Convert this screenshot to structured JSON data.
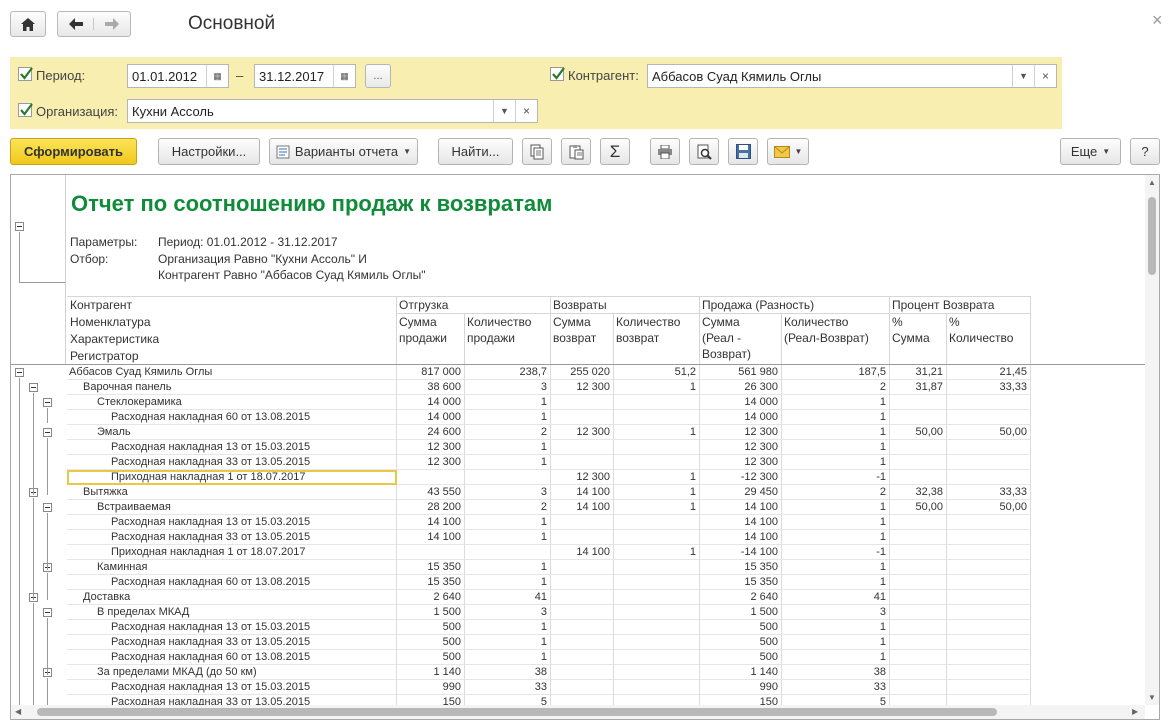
{
  "window": {
    "title": "Основной"
  },
  "params": {
    "period_label": "Период:",
    "date_from": "01.01.2012",
    "dash": "–",
    "date_to": "31.12.2017",
    "more_label": "...",
    "contractor_label": "Контрагент:",
    "contractor_value": "Аббасов Суад Кямиль Оглы",
    "org_label": "Организация:",
    "org_value": "Кухни Ассоль"
  },
  "toolbar": {
    "generate": "Сформировать",
    "settings": "Настройки...",
    "variants": "Варианты отчета",
    "find": "Найти...",
    "more": "Еще",
    "help": "?"
  },
  "report": {
    "title": "Отчет по соотношению продаж к возвратам",
    "params_label": "Параметры:",
    "params_value": "Период: 01.01.2012 - 31.12.2017",
    "filter_label": "Отбор:",
    "filter_line1": "Организация Равно \"Кухни Ассоль\" И",
    "filter_line2": "Контрагент Равно \"Аббасов Суад Кямиль Оглы\"",
    "headers": {
      "group_row1": "Контрагент",
      "group_row2": "Номенклатура",
      "group_row3": "Характеристика",
      "group_row4": "Регистратор",
      "shipment": "Отгрузка",
      "returns": "Возвраты",
      "sales_diff": "Продажа (Разность)",
      "return_pct": "Процент Возврата",
      "ship_sum": [
        "Сумма",
        "продажи"
      ],
      "ship_qty": [
        "Количество",
        "продажи"
      ],
      "ret_sum": [
        "Сумма",
        "возврат"
      ],
      "ret_qty": [
        "Количество",
        "возврат"
      ],
      "diff_sum": [
        "Сумма",
        "(Реал -",
        "Возврат)"
      ],
      "diff_qty": [
        "Количество",
        "(Реал-Возврат)"
      ],
      "pct_sum": [
        "%",
        "Сумма"
      ],
      "pct_qty": [
        "%",
        "Количество"
      ]
    },
    "rows": [
      {
        "name": "Аббасов Суад Кямиль Оглы",
        "level": 0,
        "ship_sum": "817 000",
        "ship_qty": "238,7",
        "ret_sum": "255 020",
        "ret_qty": "51,2",
        "diff_sum": "561 980",
        "diff_qty": "187,5",
        "pct_sum": "31,21",
        "pct_qty": "21,45"
      },
      {
        "name": "Варочная панель",
        "level": 1,
        "ship_sum": "38 600",
        "ship_qty": "3",
        "ret_sum": "12 300",
        "ret_qty": "1",
        "diff_sum": "26 300",
        "diff_qty": "2",
        "pct_sum": "31,87",
        "pct_qty": "33,33"
      },
      {
        "name": "Стеклокерамика",
        "level": 2,
        "ship_sum": "14 000",
        "ship_qty": "1",
        "ret_sum": "",
        "ret_qty": "",
        "diff_sum": "14 000",
        "diff_qty": "1",
        "pct_sum": "",
        "pct_qty": ""
      },
      {
        "name": "Расходная накладная 60 от 13.08.2015",
        "level": 3,
        "ship_sum": "14 000",
        "ship_qty": "1",
        "ret_sum": "",
        "ret_qty": "",
        "diff_sum": "14 000",
        "diff_qty": "1",
        "pct_sum": "",
        "pct_qty": ""
      },
      {
        "name": "Эмаль",
        "level": 2,
        "ship_sum": "24 600",
        "ship_qty": "2",
        "ret_sum": "12 300",
        "ret_qty": "1",
        "diff_sum": "12 300",
        "diff_qty": "1",
        "pct_sum": "50,00",
        "pct_qty": "50,00"
      },
      {
        "name": "Расходная накладная 13 от 15.03.2015",
        "level": 3,
        "ship_sum": "12 300",
        "ship_qty": "1",
        "ret_sum": "",
        "ret_qty": "",
        "diff_sum": "12 300",
        "diff_qty": "1",
        "pct_sum": "",
        "pct_qty": ""
      },
      {
        "name": "Расходная накладная 33 от 13.05.2015",
        "level": 3,
        "ship_sum": "12 300",
        "ship_qty": "1",
        "ret_sum": "",
        "ret_qty": "",
        "diff_sum": "12 300",
        "diff_qty": "1",
        "pct_sum": "",
        "pct_qty": ""
      },
      {
        "name": "Приходная накладная 1 от 18.07.2017",
        "level": 3,
        "selected": true,
        "ship_sum": "",
        "ship_qty": "",
        "ret_sum": "12 300",
        "ret_qty": "1",
        "diff_sum": "-12 300",
        "diff_qty": "-1",
        "pct_sum": "",
        "pct_qty": ""
      },
      {
        "name": "Вытяжка",
        "level": 1,
        "ship_sum": "43 550",
        "ship_qty": "3",
        "ret_sum": "14 100",
        "ret_qty": "1",
        "diff_sum": "29 450",
        "diff_qty": "2",
        "pct_sum": "32,38",
        "pct_qty": "33,33"
      },
      {
        "name": "Встраиваемая",
        "level": 2,
        "ship_sum": "28 200",
        "ship_qty": "2",
        "ret_sum": "14 100",
        "ret_qty": "1",
        "diff_sum": "14 100",
        "diff_qty": "1",
        "pct_sum": "50,00",
        "pct_qty": "50,00"
      },
      {
        "name": "Расходная накладная 13 от 15.03.2015",
        "level": 3,
        "ship_sum": "14 100",
        "ship_qty": "1",
        "ret_sum": "",
        "ret_qty": "",
        "diff_sum": "14 100",
        "diff_qty": "1",
        "pct_sum": "",
        "pct_qty": ""
      },
      {
        "name": "Расходная накладная 33 от 13.05.2015",
        "level": 3,
        "ship_sum": "14 100",
        "ship_qty": "1",
        "ret_sum": "",
        "ret_qty": "",
        "diff_sum": "14 100",
        "diff_qty": "1",
        "pct_sum": "",
        "pct_qty": ""
      },
      {
        "name": "Приходная накладная 1 от 18.07.2017",
        "level": 3,
        "ship_sum": "",
        "ship_qty": "",
        "ret_sum": "14 100",
        "ret_qty": "1",
        "diff_sum": "-14 100",
        "diff_qty": "-1",
        "pct_sum": "",
        "pct_qty": ""
      },
      {
        "name": "Каминная",
        "level": 2,
        "ship_sum": "15 350",
        "ship_qty": "1",
        "ret_sum": "",
        "ret_qty": "",
        "diff_sum": "15 350",
        "diff_qty": "1",
        "pct_sum": "",
        "pct_qty": ""
      },
      {
        "name": "Расходная накладная 60 от 13.08.2015",
        "level": 3,
        "ship_sum": "15 350",
        "ship_qty": "1",
        "ret_sum": "",
        "ret_qty": "",
        "diff_sum": "15 350",
        "diff_qty": "1",
        "pct_sum": "",
        "pct_qty": ""
      },
      {
        "name": "Доставка",
        "level": 1,
        "ship_sum": "2 640",
        "ship_qty": "41",
        "ret_sum": "",
        "ret_qty": "",
        "diff_sum": "2 640",
        "diff_qty": "41",
        "pct_sum": "",
        "pct_qty": ""
      },
      {
        "name": "В пределах МКАД",
        "level": 2,
        "ship_sum": "1 500",
        "ship_qty": "3",
        "ret_sum": "",
        "ret_qty": "",
        "diff_sum": "1 500",
        "diff_qty": "3",
        "pct_sum": "",
        "pct_qty": ""
      },
      {
        "name": "Расходная накладная 13 от 15.03.2015",
        "level": 3,
        "ship_sum": "500",
        "ship_qty": "1",
        "ret_sum": "",
        "ret_qty": "",
        "diff_sum": "500",
        "diff_qty": "1",
        "pct_sum": "",
        "pct_qty": ""
      },
      {
        "name": "Расходная накладная 33 от 13.05.2015",
        "level": 3,
        "ship_sum": "500",
        "ship_qty": "1",
        "ret_sum": "",
        "ret_qty": "",
        "diff_sum": "500",
        "diff_qty": "1",
        "pct_sum": "",
        "pct_qty": ""
      },
      {
        "name": "Расходная накладная 60 от 13.08.2015",
        "level": 3,
        "ship_sum": "500",
        "ship_qty": "1",
        "ret_sum": "",
        "ret_qty": "",
        "diff_sum": "500",
        "diff_qty": "1",
        "pct_sum": "",
        "pct_qty": ""
      },
      {
        "name": "За пределами МКАД (до 50 км)",
        "level": 2,
        "ship_sum": "1 140",
        "ship_qty": "38",
        "ret_sum": "",
        "ret_qty": "",
        "diff_sum": "1 140",
        "diff_qty": "38",
        "pct_sum": "",
        "pct_qty": ""
      },
      {
        "name": "Расходная накладная 13 от 15.03.2015",
        "level": 3,
        "ship_sum": "990",
        "ship_qty": "33",
        "ret_sum": "",
        "ret_qty": "",
        "diff_sum": "990",
        "diff_qty": "33",
        "pct_sum": "",
        "pct_qty": ""
      },
      {
        "name": "Расходная накладная 33 от 13.05.2015",
        "level": 3,
        "ship_sum": "150",
        "ship_qty": "5",
        "ret_sum": "",
        "ret_qty": "",
        "diff_sum": "150",
        "diff_qty": "5",
        "pct_sum": "",
        "pct_qty": ""
      }
    ]
  },
  "icons": {
    "home": "home-icon",
    "back": "arrow-left-icon",
    "forward": "arrow-right-icon",
    "calendar": "calendar-icon",
    "dropdown": "chevron-down-icon",
    "clear": "clear-icon",
    "variants": "report-variants-icon",
    "copy": "copy-icon",
    "paste": "paste-icon",
    "sum": "sum-icon",
    "print": "print-icon",
    "preview": "print-preview-icon",
    "save": "save-icon",
    "mail": "mail-icon"
  },
  "colors": {
    "title_green": "#0f8b3a",
    "param_bg": "#f8eeb0",
    "primary_button": "#f1c81b",
    "selection": "#e8c844"
  }
}
